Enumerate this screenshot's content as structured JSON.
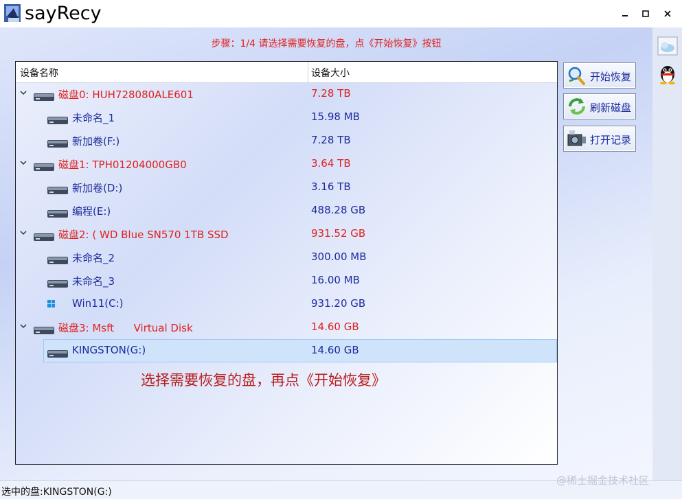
{
  "window": {
    "title": "sayRecy"
  },
  "step_instruction": "步骤：1/4 请选择需要恢复的盘，点《开始恢复》按钮",
  "columns": {
    "name": "设备名称",
    "size": "设备大小"
  },
  "tree_rows": [
    {
      "level": 0,
      "name": "磁盘0: HUH728080ALE601",
      "size": "7.28 TB"
    },
    {
      "level": 1,
      "name": "未命名_1",
      "size": "15.98 MB"
    },
    {
      "level": 1,
      "name": "新加卷(F:)",
      "size": "7.28 TB"
    },
    {
      "level": 0,
      "name": "磁盘1: TPH01204000GB0",
      "size": "3.64 TB"
    },
    {
      "level": 1,
      "name": "新加卷(D:)",
      "size": "3.16 TB"
    },
    {
      "level": 1,
      "name": "编程(E:)",
      "size": "488.28 GB"
    },
    {
      "level": 0,
      "name": "磁盘2: ( WD Blue SN570 1TB SSD",
      "size": "931.52 GB"
    },
    {
      "level": 1,
      "name": "未命名_2",
      "size": "300.00 MB"
    },
    {
      "level": 1,
      "name": "未命名_3",
      "size": "16.00 MB"
    },
    {
      "level": 1,
      "name": "Win11(C:)",
      "size": "931.20 GB",
      "icon": "windows-icon"
    },
    {
      "level": 0,
      "name": "磁盘3: Msft      Virtual Disk",
      "size": "14.60 GB"
    },
    {
      "level": 1,
      "name": "KINGSTON(G:)",
      "size": "14.60 GB",
      "selected": true
    }
  ],
  "hint_text": "选择需要恢复的盘，再点《开始恢复》",
  "buttons": {
    "start": "开始恢复",
    "refresh": "刷新磁盘",
    "open_log": "打开记录"
  },
  "status_bar": "选中的盘:KINGSTON(G:)",
  "watermark": "@稀土掘金技术社区",
  "colors": {
    "disk_text": "#e0201e",
    "volume_text": "#1b2a9c",
    "selection": "#cfe4fb"
  }
}
